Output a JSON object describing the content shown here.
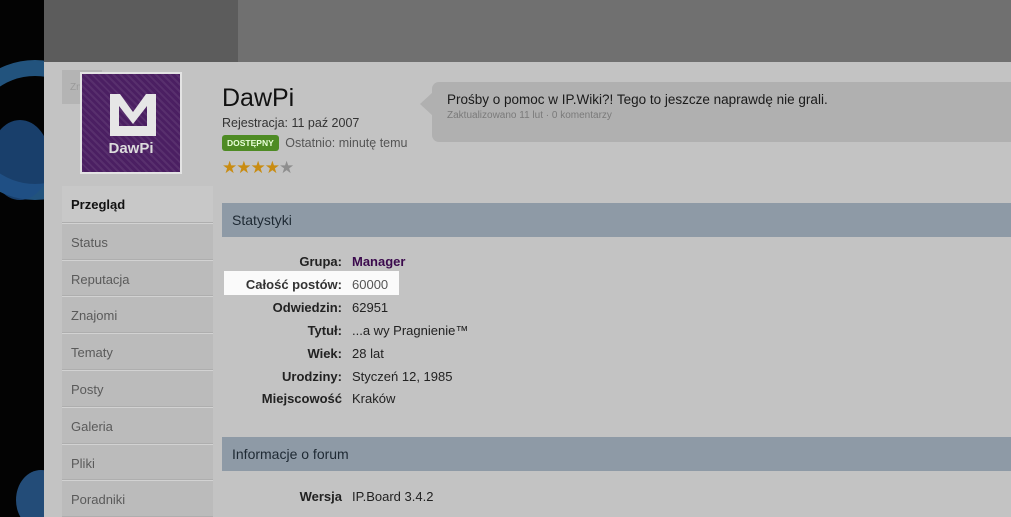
{
  "edit_link": "Zmień",
  "avatar": {
    "name": "DawPi",
    "accent": "#4b1f62"
  },
  "sidebar": {
    "tabs": [
      {
        "label": "Przegląd",
        "active": true
      },
      {
        "label": "Status"
      },
      {
        "label": "Reputacja"
      },
      {
        "label": "Znajomi"
      },
      {
        "label": "Tematy"
      },
      {
        "label": "Posty"
      },
      {
        "label": "Galeria"
      },
      {
        "label": "Pliki"
      },
      {
        "label": "Poradniki"
      }
    ]
  },
  "profile": {
    "username": "DawPi",
    "joined": "Rejestracja: 11 paź 2007",
    "online_badge": "DOSTĘPNY",
    "last_seen": "Ostatnio: minutę temu",
    "rating": 4,
    "rating_max": 5
  },
  "status_update": {
    "text": "Prośby o pomoc w IP.Wiki?! Tego to jeszcze naprawdę nie grali.",
    "meta": "Zaktualizowano 11 lut · 0 komentarzy"
  },
  "sections": {
    "stats_title": "Statystyki",
    "forum_title": "Informacje o forum"
  },
  "stats": [
    {
      "label": "Grupa:",
      "value": "Manager"
    },
    {
      "label": "Całość postów:",
      "value": "60000"
    },
    {
      "label": "Odwiedzin:",
      "value": "62951"
    },
    {
      "label": "Tytuł:",
      "value": "...a wy Pragnienie™"
    },
    {
      "label": "Wiek:",
      "value": "28 lat"
    },
    {
      "label": "Urodziny:",
      "value": "Styczeń 12, 1985"
    },
    {
      "label": "Miejscowość",
      "value": "Kraków"
    }
  ],
  "forum_info": [
    {
      "label": "Wersja",
      "value": "IP.Board 3.4.2"
    }
  ],
  "colors": {
    "online_badge": "#4e8b24",
    "group": "#3b0a4d",
    "section_header": "#8e9aa6",
    "star": "#c98c12"
  }
}
